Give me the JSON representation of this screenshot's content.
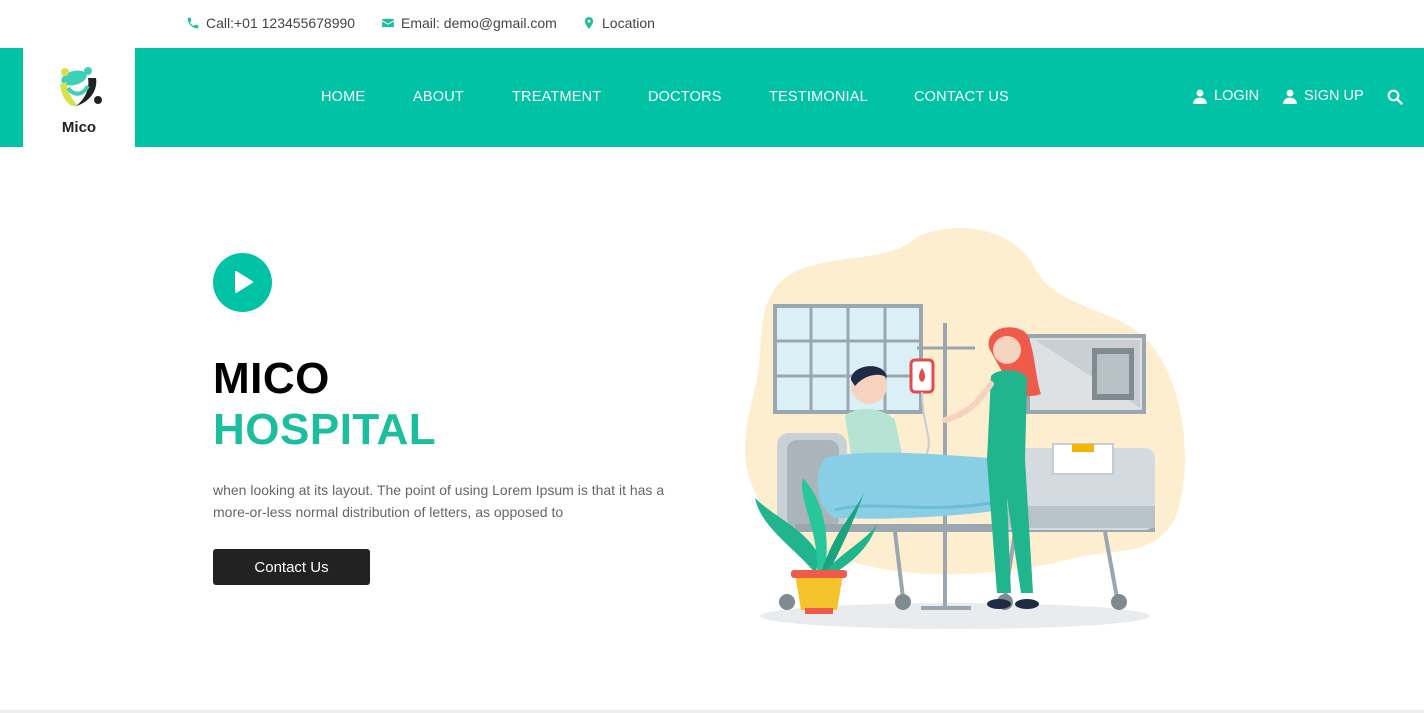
{
  "topbar": {
    "phone": "Call:+01 123455678990",
    "email": "Email: demo@gmail.com",
    "location": "Location"
  },
  "brand": {
    "name": "Mico"
  },
  "nav": {
    "items": [
      {
        "label": "HOME"
      },
      {
        "label": "ABOUT"
      },
      {
        "label": "TREATMENT"
      },
      {
        "label": "DOCTORS"
      },
      {
        "label": "TESTIMONIAL"
      },
      {
        "label": "CONTACT US"
      }
    ],
    "login": "LOGIN",
    "signup": "SIGN UP"
  },
  "hero": {
    "title_line1": "MICO",
    "title_line2": "HOSPITAL",
    "description": "when looking at its layout. The point of using Lorem Ipsum is that it has a more-or-less normal distribution of letters, as opposed to",
    "cta_label": "Contact Us"
  },
  "colors": {
    "accent": "#00c3a5",
    "dark_button": "#222222",
    "title_dark": "#000000"
  },
  "icons": {
    "phone": "phone-icon",
    "email": "envelope-icon",
    "location": "map-pin-icon",
    "user": "user-icon",
    "search": "search-icon",
    "play": "play-icon"
  }
}
